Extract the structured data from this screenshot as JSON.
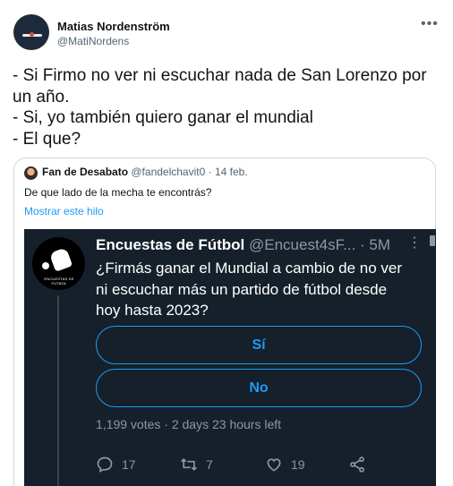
{
  "author": {
    "name": "Matias Nordenström",
    "handle": "@MatiNordens"
  },
  "tweet": {
    "lines": [
      "- Si Firmo no ver ni escuchar nada de San Lorenzo por",
      "un año.",
      "- Si, yo también quiero ganar el mundial",
      "- El que?"
    ]
  },
  "quote": {
    "name": "Fan de Desabato",
    "handle": "@fandelchavit0",
    "date": "14 feb.",
    "text": "De que lado de la mecha te encontrás?",
    "show_thread": "Mostrar este hilo",
    "embed": {
      "name": "Encuestas de Fútbol",
      "handle": "@Encuest4sF...",
      "time": "5M",
      "avatar_text": "ENCUESTAS DE FUTBOL",
      "question_lines": [
        "¿Firmás ganar el Mundial a cambio de no ver",
        "ni escuchar más un partido de fútbol desde",
        "hoy hasta 2023?"
      ],
      "poll": {
        "options": [
          "Sí",
          "No"
        ],
        "votes": "1,199 votes",
        "time_left": "2 days 23 hours left"
      },
      "stats": {
        "replies": "17",
        "retweets": "7",
        "likes": "19"
      }
    }
  },
  "colors": {
    "accent": "#1d9bf0",
    "embed_bg": "#15202b",
    "muted": "#536471",
    "embed_muted": "#8b98a5"
  }
}
